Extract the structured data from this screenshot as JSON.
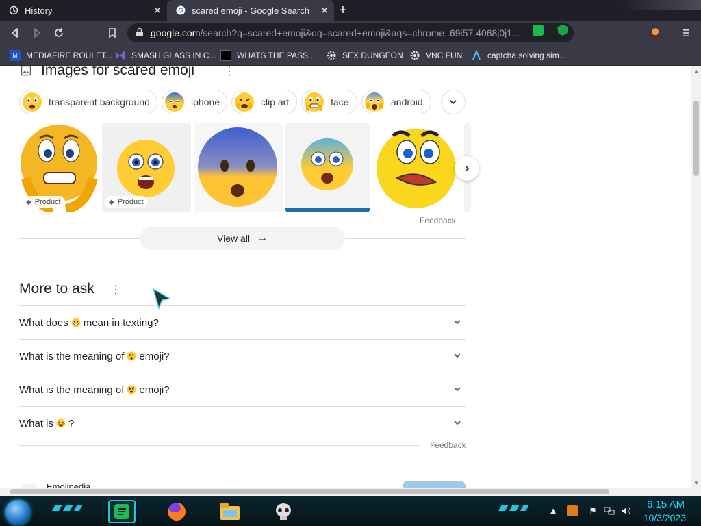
{
  "browser": {
    "tabs": [
      {
        "title": "History",
        "active": false
      },
      {
        "title": "scared emoji - Google Search",
        "active": true
      }
    ],
    "new_tab_label": "+",
    "close_glyph": "✕",
    "address": {
      "host": "google.com",
      "path": "/search?q=scared+emoji&oq=scared+emoji&aqs=chrome..69i57.4068j0j1..."
    },
    "bookmarks": [
      {
        "label": "MEDIAFIRE ROULET...",
        "icon": "mediafire-icon"
      },
      {
        "label": "SMASH GLASS IN C...",
        "icon": "vs-icon"
      },
      {
        "label": "WHATS THE PASS...",
        "icon": "square-icon"
      },
      {
        "label": "SEX DUNGEON",
        "icon": "gear-icon"
      },
      {
        "label": "VNC FUN",
        "icon": "gear-icon"
      },
      {
        "label": "captcha solving sim...",
        "icon": "a-icon"
      }
    ]
  },
  "images_section": {
    "title": "Images for scared emoji",
    "chips": [
      {
        "label": "transparent background"
      },
      {
        "label": "iphone"
      },
      {
        "label": "clip art"
      },
      {
        "label": "face"
      },
      {
        "label": "android"
      }
    ],
    "product_tag": "Product",
    "feedback": "Feedback",
    "view_all": "View all"
  },
  "more_to_ask": {
    "title": "More to ask",
    "questions": [
      {
        "before": "What does",
        "after": "mean in texting?"
      },
      {
        "before": "What is the meaning of",
        "after": "emoji?"
      },
      {
        "before": "What is the meaning of",
        "after": "emoji?"
      },
      {
        "before": "What is",
        "after": "?"
      }
    ],
    "feedback": "Feedback"
  },
  "result": {
    "source_name": "Emojipedia"
  },
  "taskbar": {
    "time": "6:15 AM",
    "date": "10/3/2023"
  },
  "colors": {
    "chrome_dark": "#3a3a46",
    "tab_strip": "#1f1f27",
    "accent_cyan": "#19e0ff",
    "emoji_yellow": "#ffcc33"
  }
}
